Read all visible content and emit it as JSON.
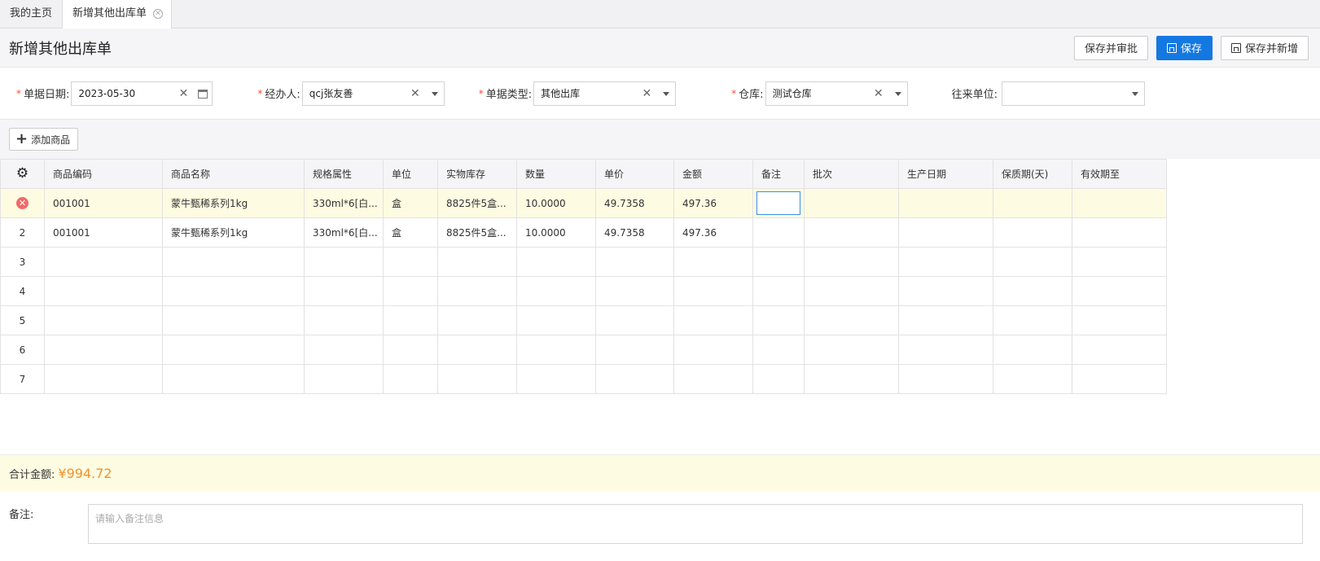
{
  "tabs": [
    {
      "label": "我的主页"
    },
    {
      "label": "新增其他出库单"
    }
  ],
  "header": {
    "title": "新增其他出库单",
    "buttons": {
      "save_approve": "保存并审批",
      "save": "保存",
      "save_new": "保存并新增"
    }
  },
  "form": {
    "date": {
      "label": "单据日期:",
      "value": "2023-05-30"
    },
    "handler": {
      "label": "经办人:",
      "value": "qcj张友善"
    },
    "doc_type": {
      "label": "单据类型:",
      "value": "其他出库"
    },
    "warehouse": {
      "label": "仓库:",
      "value": "测试仓库"
    },
    "partner": {
      "label": "往来单位:",
      "value": ""
    }
  },
  "toolbar": {
    "add_goods": "添加商品"
  },
  "table": {
    "columns": [
      "商品编码",
      "商品名称",
      "规格属性",
      "单位",
      "实物库存",
      "数量",
      "单价",
      "金额",
      "备注",
      "批次",
      "生产日期",
      "保质期(天)",
      "有效期至"
    ],
    "rows": [
      {
        "idx": "",
        "code": "001001",
        "name": "蒙牛甄稀系列1kg",
        "spec": "330ml*6[白...",
        "unit": "盒",
        "stock": "8825件5盒...",
        "qty": "10.0000",
        "price": "49.7358",
        "amount": "497.36",
        "remark": "",
        "batch": "",
        "mfg": "",
        "shelf": "",
        "expiry": ""
      },
      {
        "idx": "2",
        "code": "001001",
        "name": "蒙牛甄稀系列1kg",
        "spec": "330ml*6[白...",
        "unit": "盒",
        "stock": "8825件5盒...",
        "qty": "10.0000",
        "price": "49.7358",
        "amount": "497.36",
        "remark": "",
        "batch": "",
        "mfg": "",
        "shelf": "",
        "expiry": ""
      },
      {
        "idx": "3"
      },
      {
        "idx": "4"
      },
      {
        "idx": "5"
      },
      {
        "idx": "6"
      },
      {
        "idx": "7"
      }
    ]
  },
  "summary": {
    "label": "合计金额:",
    "value": "¥994.72"
  },
  "remark": {
    "label": "备注:",
    "placeholder": "请输入备注信息"
  },
  "colors": {
    "primary": "#1478e1",
    "amount": "#f0932b",
    "selected_row": "#fdfbe1",
    "delete": "#f06a6a"
  }
}
